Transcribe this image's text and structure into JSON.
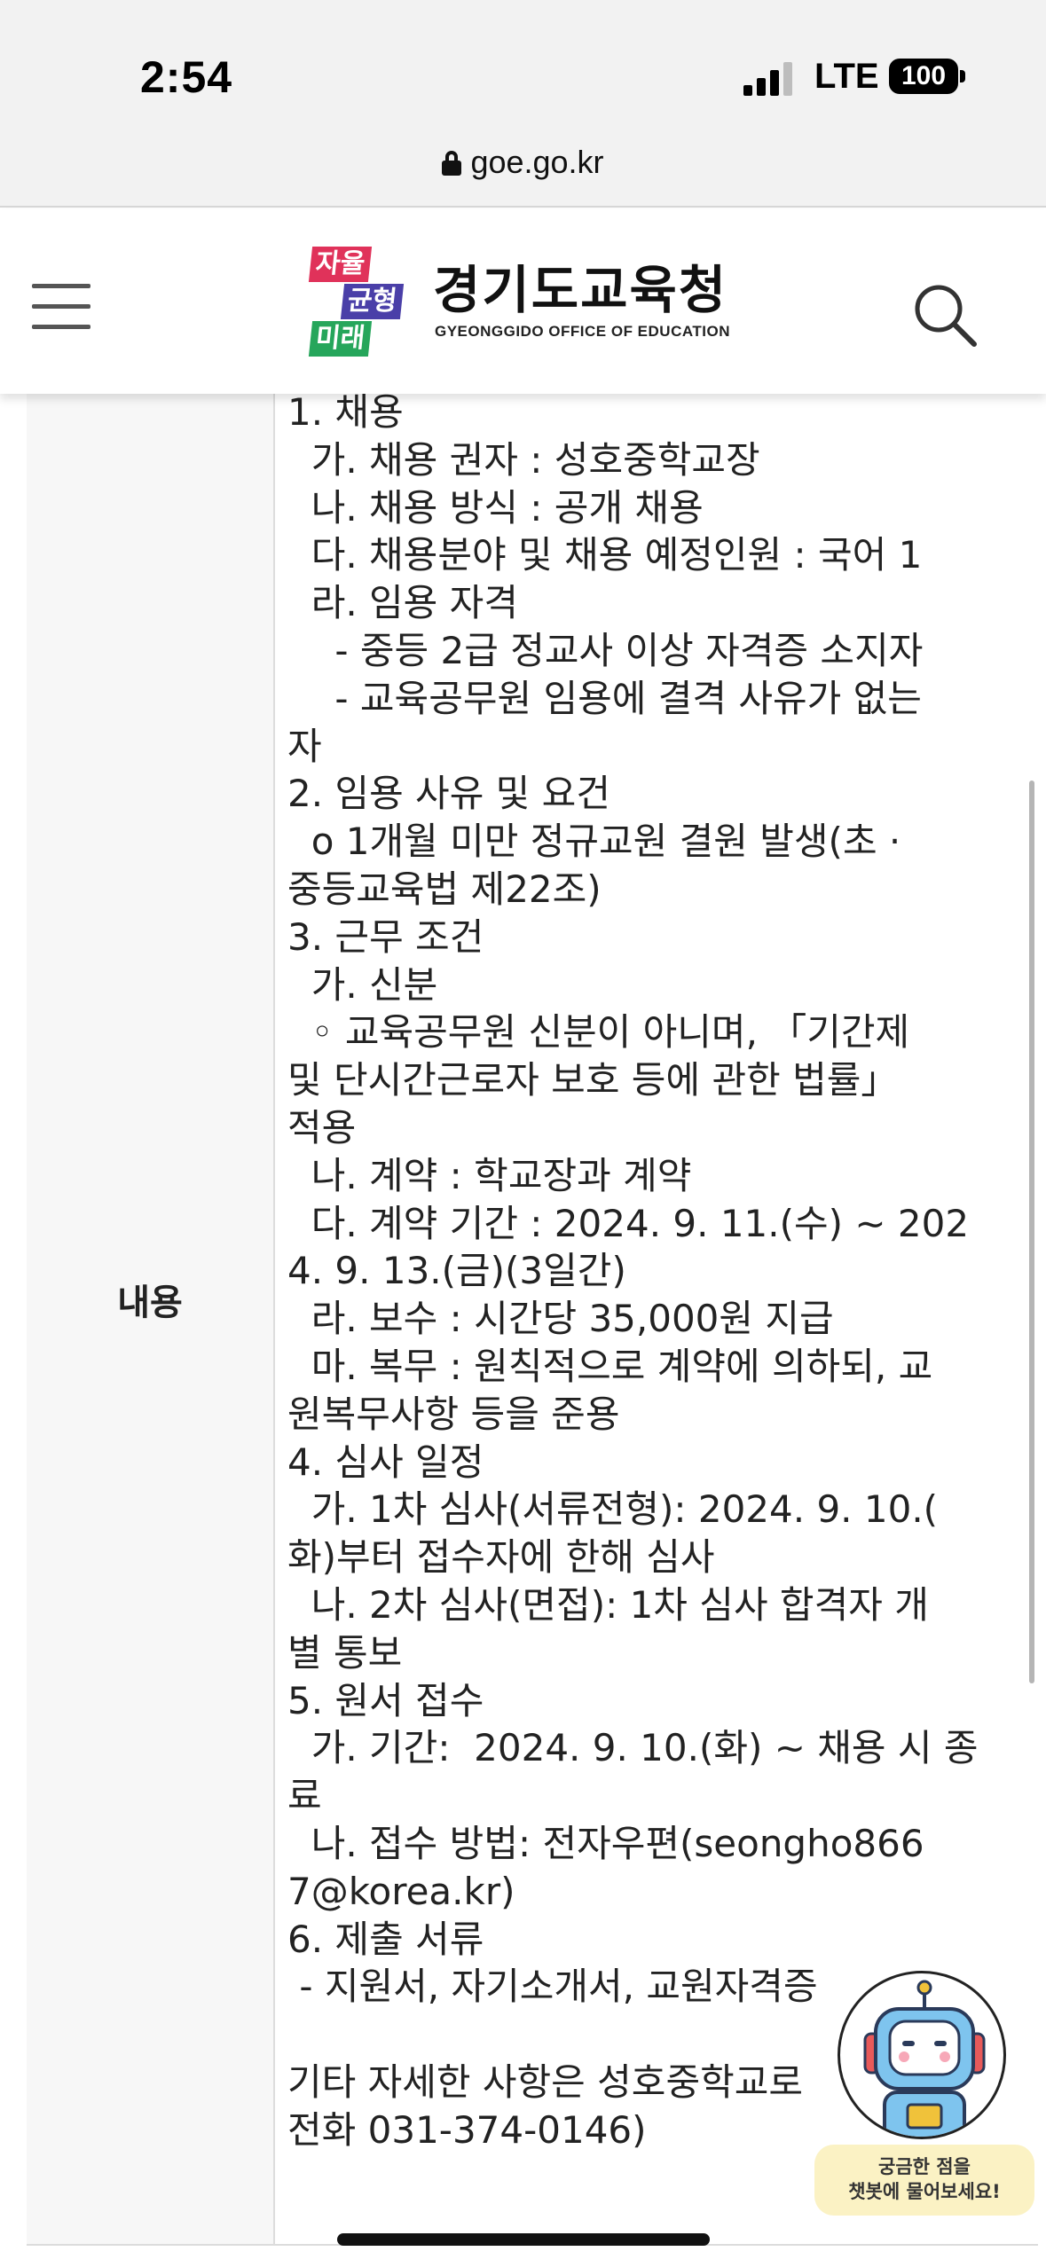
{
  "status_bar": {
    "time": "2:54",
    "network": "LTE",
    "battery": "100"
  },
  "browser": {
    "url": "goe.go.kr"
  },
  "header": {
    "logo_tags": [
      "자율",
      "균형",
      "미래"
    ],
    "logo_title": "경기도교육청",
    "logo_subtitle": "GYEONGGIDO OFFICE OF EDUCATION",
    "menu_icon": "hamburger-menu-icon",
    "search_icon": "search-icon"
  },
  "content": {
    "row_label": "내용",
    "body": "1. 채용\n  가. 채용 권자 : 성호중학교장\n  나. 채용 방식 : 공개 채용\n  다. 채용분야 및 채용 예정인원 : 국어 1\n  라. 임용 자격\n    - 중등 2급 정교사 이상 자격증 소지자\n    - 교육공무원 임용에 결격 사유가 없는\n자\n2. 임용 사유 및 요건\n  o 1개월 미만 정규교원 결원 발생(초 ·\n중등교육법 제22조)\n3. 근무 조건\n  가. 신분\n  ◦ 교육공무원 신분이 아니며, 「기간제\n및 단시간근로자 보호 등에 관한 법률」\n적용\n  나. 계약 : 학교장과 계약\n  다. 계약 기간 : 2024. 9. 11.(수) ∼ 202\n4. 9. 13.(금)(3일간)\n  라. 보수 : 시간당 35,000원 지급\n  마. 복무 : 원칙적으로 계약에 의하되, 교\n원복무사항 등을 준용\n4. 심사 일정\n  가. 1차 심사(서류전형): 2024. 9. 10.(\n화)부터 접수자에 한해 심사\n  나. 2차 심사(면접): 1차 심사 합격자 개\n별 통보\n5. 원서 접수\n  가. 기간:  2024. 9. 10.(화) ~ 채용 시 종\n료\n  나. 접수 방법: 전자우편(seongho866\n7@korea.kr)\n6. 제출 서류\n - 지원서, 자기소개서, 교원자격증\n\n기타 자세한 사항은 성호중학교로\n전화 031-374-0146)"
  },
  "chatbot": {
    "line1": "궁금한 점을",
    "line2": "챗봇에 물어보세요!",
    "icon": "chatbot-robot-icon"
  },
  "colors": {
    "tag_red": "#e0325a",
    "tag_purple": "#4a3fa8",
    "tag_green": "#26a65b",
    "bubble": "#fbf2c4"
  }
}
